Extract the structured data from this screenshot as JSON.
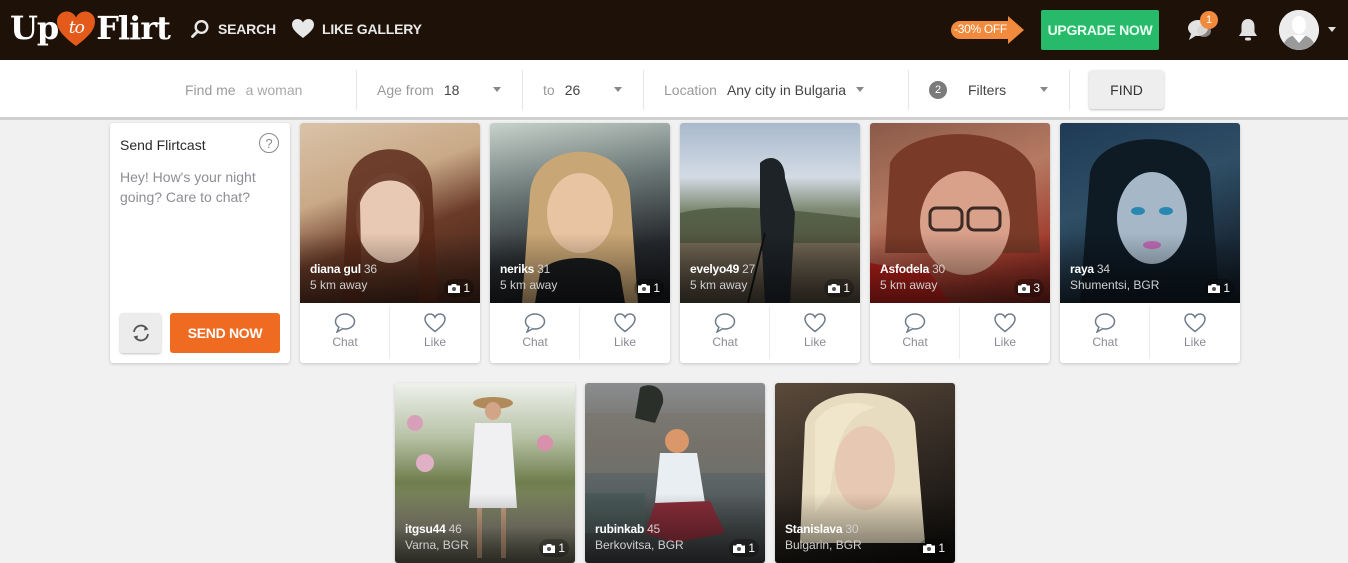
{
  "header": {
    "logo": {
      "left": "Up",
      "middle": "to",
      "right": "Flirt"
    },
    "nav": [
      {
        "label": "SEARCH",
        "icon": "search-icon"
      },
      {
        "label": "LIKE GALLERY",
        "icon": "heart-icon"
      }
    ],
    "discount_label": "-30% OFF",
    "upgrade_label": "UPGRADE NOW",
    "messages_badge": "1",
    "colors": {
      "bar": "#1e1208",
      "upgrade": "#27ba6a",
      "discount": "#f18a3c",
      "brand": "#e35a1b"
    }
  },
  "filters": {
    "find_me_label": "Find me",
    "find_me_value": "a woman",
    "age_from_label": "Age from",
    "age_from_value": "18",
    "age_to_label": "to",
    "age_to_value": "26",
    "location_label": "Location",
    "location_value": "Any city in Bulgaria",
    "filters_count": "2",
    "filters_label": "Filters",
    "find_button": "FIND"
  },
  "flirtcast": {
    "title": "Send Flirtcast",
    "help": "?",
    "message": "Hey! How's your night going? Care to chat?",
    "send_label": "SEND NOW",
    "send_color": "#f06b22"
  },
  "profiles": [
    {
      "name": "diana gul",
      "age": "36",
      "location": "5 km away",
      "photos": "1",
      "chat": "Chat",
      "like": "Like"
    },
    {
      "name": "neriks",
      "age": "31",
      "location": "5 km away",
      "photos": "1",
      "chat": "Chat",
      "like": "Like"
    },
    {
      "name": "evelyo49",
      "age": "27",
      "location": "5 km away",
      "photos": "1",
      "chat": "Chat",
      "like": "Like"
    },
    {
      "name": "Asfodela",
      "age": "30",
      "location": "5 km away",
      "photos": "3",
      "chat": "Chat",
      "like": "Like"
    },
    {
      "name": "raya",
      "age": "34",
      "location": "Shumentsi, BGR",
      "photos": "1",
      "chat": "Chat",
      "like": "Like"
    },
    {
      "name": "itgsu44",
      "age": "46",
      "location": "Varna, BGR",
      "photos": "1"
    },
    {
      "name": "rubinkab",
      "age": "45",
      "location": "Berkovitsa, BGR",
      "photos": "1"
    },
    {
      "name": "Stanislava",
      "age": "30",
      "location": "Bulgarin, BGR",
      "photos": "1"
    }
  ]
}
